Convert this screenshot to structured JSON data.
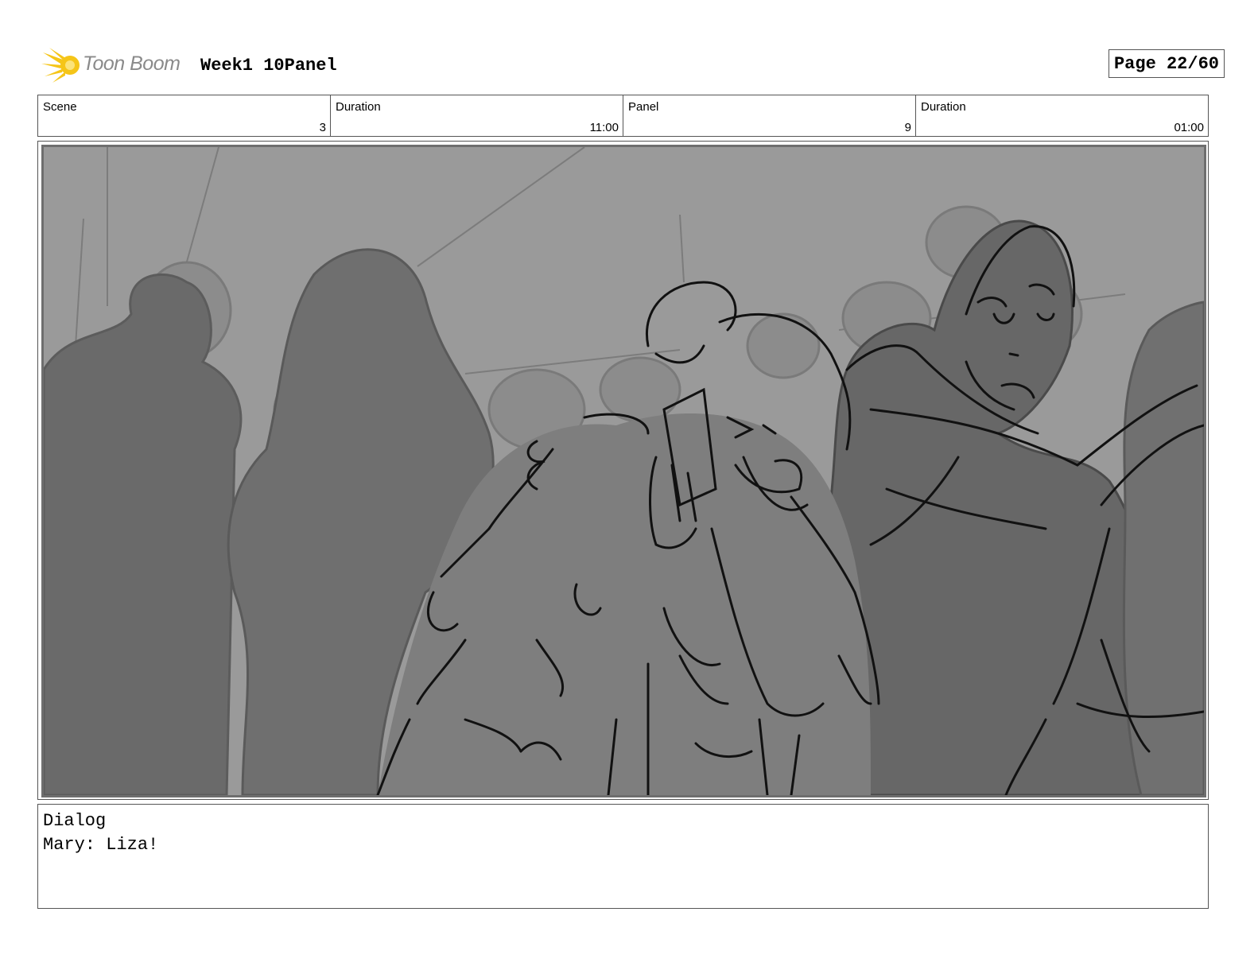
{
  "header": {
    "logo_text": "Toon Boom",
    "title": "Week1 10Panel",
    "page_label": "Page 22/60"
  },
  "info": {
    "scene_label": "Scene",
    "scene_value": "3",
    "scene_duration_label": "Duration",
    "scene_duration_value": "11:00",
    "panel_label": "Panel",
    "panel_value": "9",
    "panel_duration_label": "Duration",
    "panel_duration_value": "01:00"
  },
  "dialog": {
    "label": "Dialog",
    "line": "Mary: Liza!"
  },
  "colors": {
    "logo_star": "#f5c518",
    "logo_text": "#8a8a8a",
    "panel_background": "#9a9a9a",
    "crowd_light": "#8c8c8c",
    "crowd_mid": "#7a7a7a",
    "crowd_dark": "#666666",
    "sketch_line": "#111111"
  }
}
